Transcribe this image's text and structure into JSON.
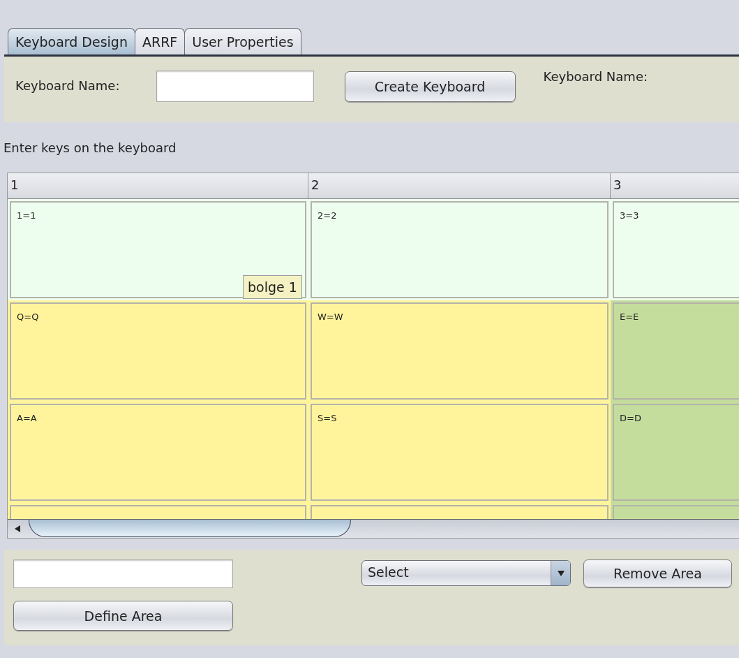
{
  "tabs": [
    {
      "label": "Keyboard Design",
      "selected": true
    },
    {
      "label": "ARRF",
      "selected": false
    },
    {
      "label": "User Properties",
      "selected": false
    }
  ],
  "top_form": {
    "name_label": "Keyboard Name:",
    "create_button": "Create Keyboard",
    "current_name_label": "Keyboard Name:"
  },
  "instruction": "Enter keys on the keyboard",
  "table": {
    "columns": [
      "1",
      "2",
      "3"
    ],
    "rows": [
      {
        "cells": [
          {
            "text": "1=1",
            "color": "#eefeee"
          },
          {
            "text": "2=2",
            "color": "#eefeee"
          },
          {
            "text": "3=3",
            "color": "#eefeee"
          }
        ]
      },
      {
        "cells": [
          {
            "text": "Q=Q",
            "color": "#fff49c"
          },
          {
            "text": "W=W",
            "color": "#fff49c"
          },
          {
            "text": "E=E",
            "color": "#c4dd9d"
          }
        ]
      },
      {
        "cells": [
          {
            "text": "A=A",
            "color": "#fff49c"
          },
          {
            "text": "S=S",
            "color": "#fff49c"
          },
          {
            "text": "D=D",
            "color": "#c4dd9d"
          }
        ]
      },
      {
        "cells": [
          {
            "color": "#fff49c"
          },
          {
            "color": "#fff49c"
          },
          {
            "color": "#c4dd9d"
          }
        ]
      }
    ],
    "tooltip": "bolge 1"
  },
  "bottom_form": {
    "select": {
      "value": "Select"
    },
    "remove_button": "Remove Area",
    "define_button": "Define Area"
  }
}
